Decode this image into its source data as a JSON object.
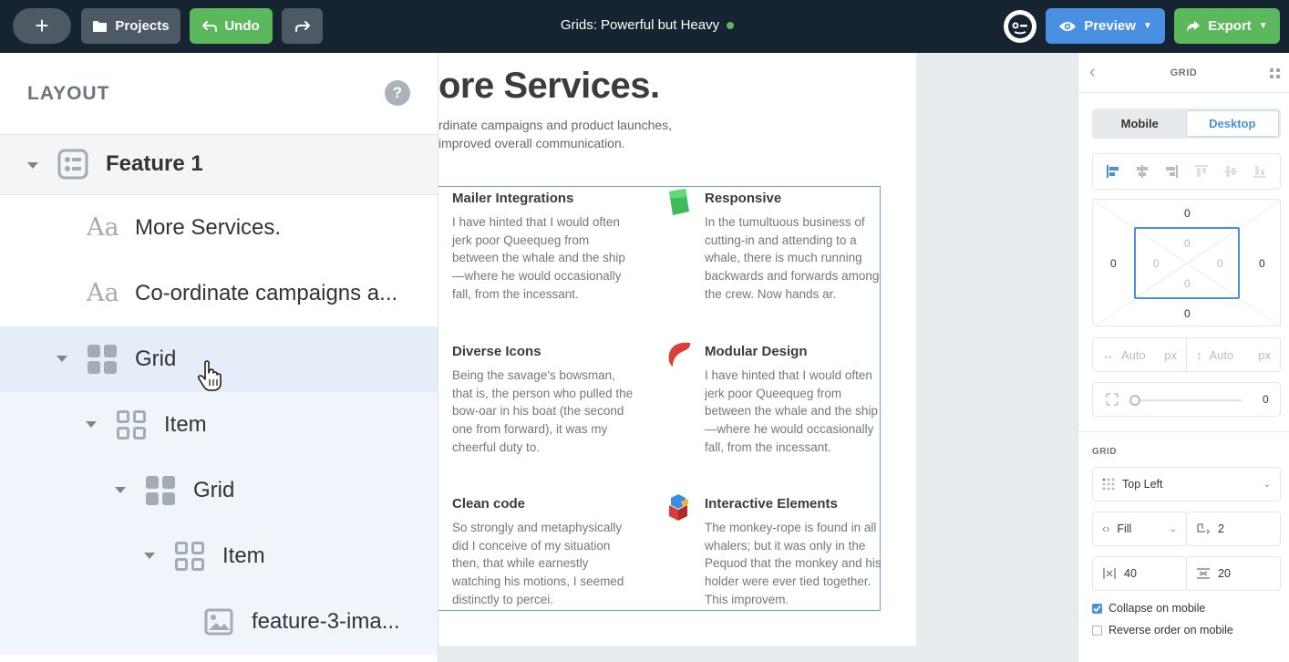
{
  "topbar": {
    "add_label": "+",
    "projects_label": "Projects",
    "undo_label": "Undo",
    "redo_label": "↷",
    "title": "Grids: Powerful but Heavy",
    "preview_label": "Preview",
    "export_label": "Export",
    "colors": {
      "bar": "#152430",
      "green": "#5cb85c",
      "blue": "#4a90e2"
    }
  },
  "layout_panel": {
    "title": "LAYOUT",
    "help_label": "?",
    "tree": [
      {
        "label": "Feature 1",
        "icon": "section-icon"
      },
      {
        "label": "More Services.",
        "icon": "text-icon"
      },
      {
        "label": "Co-ordinate campaigns a...",
        "icon": "text-icon"
      },
      {
        "label": "Grid",
        "icon": "grid-icon"
      },
      {
        "label": "Item",
        "icon": "grid-item-icon"
      },
      {
        "label": "Grid",
        "icon": "grid-icon"
      },
      {
        "label": "Item",
        "icon": "grid-item-icon"
      },
      {
        "label": "feature-3-ima...",
        "icon": "image-icon"
      }
    ],
    "text_icon_glyph": "Aa"
  },
  "canvas": {
    "heading": "ore Services.",
    "subheading": "rdinate campaigns and product launches, improved overall communication.",
    "features": [
      {
        "title": "Mailer Integrations",
        "body": "I have hinted that I would often jerk poor Queequeg from between the whale and the ship—where he would occasionally fall, from the incessant."
      },
      {
        "title": "Responsive",
        "body": "In the tumultuous business of cutting-in and attending to a whale, there is much running backwards and forwards among the crew. Now hands ar."
      },
      {
        "title": "Diverse Icons",
        "body": "Being the savage's bowsman, that is, the person who pulled the bow-oar in his boat (the second one from forward), it was my cheerful duty to."
      },
      {
        "title": "Modular Design",
        "body": "I have hinted that I would often jerk poor Queequeg from between the whale and the ship—where he would occasionally fall, from the incessant."
      },
      {
        "title": "Clean code",
        "body": "So strongly and metaphysically did I conceive of my situation then, that while earnestly watching his motions, I seemed distinctly to percei."
      },
      {
        "title": "Interactive Elements",
        "body": "The monkey-rope is found in all whalers; but it was only in the Pequod that the monkey and his holder were ever tied together. This improvem."
      }
    ]
  },
  "props_panel": {
    "title": "GRID",
    "mobile_label": "Mobile",
    "desktop_label": "Desktop",
    "margin": {
      "top": "0",
      "right": "0",
      "bottom": "0",
      "left": "0"
    },
    "padding": {
      "top": "0",
      "right": "0",
      "bottom": "0",
      "left": "0"
    },
    "width_placeholder": "Auto",
    "height_placeholder": "Auto",
    "unit": "px",
    "radius_value": "0",
    "section_label": "GRID",
    "alignment_value": "Top Left",
    "fill_value": "Fill",
    "columns_value": "2",
    "column_gap_value": "40",
    "row_gap_value": "20",
    "collapse_label": "Collapse on mobile",
    "collapse_checked": true,
    "reverse_label": "Reverse order on mobile",
    "reverse_checked": false
  }
}
